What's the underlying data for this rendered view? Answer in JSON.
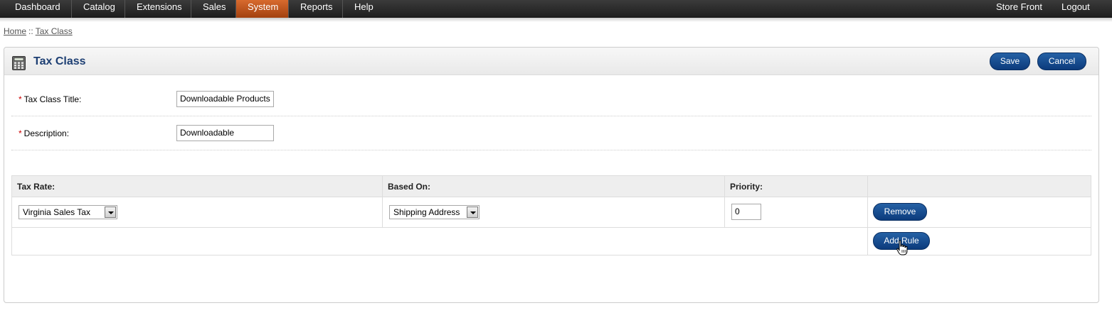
{
  "menu": {
    "items": [
      "Dashboard",
      "Catalog",
      "Extensions",
      "Sales",
      "System",
      "Reports",
      "Help"
    ],
    "active": "System",
    "right": [
      "Store Front",
      "Logout"
    ]
  },
  "breadcrumb": {
    "home": "Home",
    "sep": "::",
    "current": "Tax Class"
  },
  "box": {
    "title": "Tax Class",
    "icon": "calculator-icon",
    "save_label": "Save",
    "cancel_label": "Cancel"
  },
  "form": {
    "required_mark": "*",
    "title_label": "Tax Class Title:",
    "title_value": "Downloadable Products",
    "description_label": "Description:",
    "description_value": "Downloadable"
  },
  "rules": {
    "headers": [
      "Tax Rate:",
      "Based On:",
      "Priority:"
    ],
    "rows": [
      {
        "tax_rate": "Virginia Sales Tax",
        "based_on": "Shipping Address",
        "priority": "0",
        "remove_label": "Remove"
      }
    ],
    "add_label": "Add Rule"
  },
  "colors": {
    "accent": "#0c3b7c",
    "menu_active": "#c0531c",
    "title": "#1d3f73"
  }
}
